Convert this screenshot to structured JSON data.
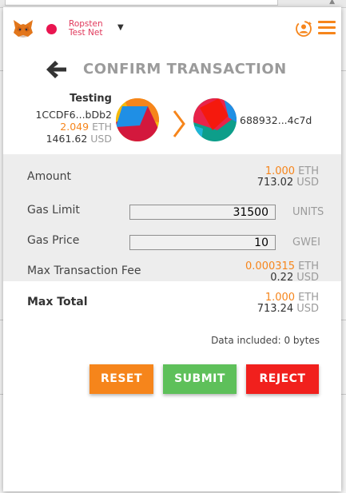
{
  "network": {
    "name": "Ropsten Test Net",
    "dot_color": "#e91550"
  },
  "title": "CONFIRM TRANSACTION",
  "from": {
    "name": "Testing",
    "address": "1CCDF6...bDb2",
    "eth_value": "2.049",
    "eth_unit": "ETH",
    "usd_value": "1461.62",
    "usd_unit": "USD"
  },
  "to": {
    "address": "688932...4c7d"
  },
  "details": {
    "amount": {
      "label": "Amount",
      "eth": "1.000",
      "eth_unit": "ETH",
      "usd": "713.02",
      "usd_unit": "USD"
    },
    "gas_limit": {
      "label": "Gas Limit",
      "value": "31500",
      "unit": "UNITS"
    },
    "gas_price": {
      "label": "Gas Price",
      "value": "10",
      "unit": "GWEI"
    },
    "max_fee": {
      "label": "Max Transaction Fee",
      "eth": "0.000315",
      "eth_unit": "ETH",
      "usd": "0.22",
      "usd_unit": "USD"
    }
  },
  "total": {
    "label": "Max Total",
    "eth": "1.000",
    "eth_unit": "ETH",
    "usd": "713.24",
    "usd_unit": "USD"
  },
  "data_included": "Data included: 0 bytes",
  "buttons": {
    "reset": "RESET",
    "submit": "SUBMIT",
    "reject": "REJECT"
  },
  "colors": {
    "accent": "#f6851b",
    "submit": "#5ec05a",
    "reject": "#f1201d"
  }
}
